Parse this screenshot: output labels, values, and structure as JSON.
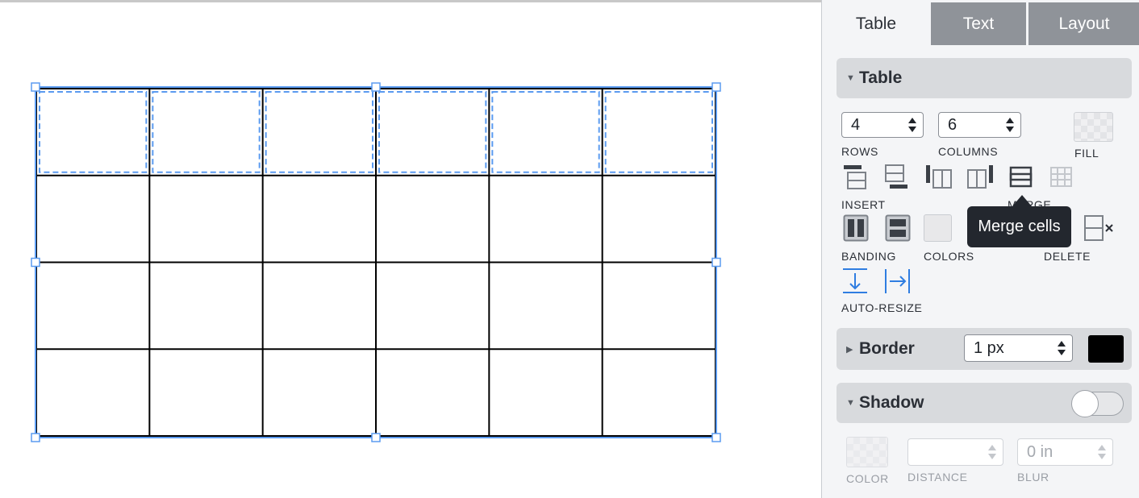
{
  "tabs": [
    {
      "label": "Table",
      "active": true
    },
    {
      "label": "Text",
      "active": false
    },
    {
      "label": "Layout",
      "active": false
    }
  ],
  "table_section": {
    "title": "Table",
    "rows_value": "4",
    "columns_value": "6",
    "rows_label": "ROWS",
    "columns_label": "COLUMNS",
    "fill_label": "FILL",
    "insert_label": "INSERT",
    "merge_label": "MERGE",
    "banding_label": "BANDING",
    "colors_label": "COLORS",
    "delete_label": "DELETE",
    "autoresize_label": "AUTO-RESIZE",
    "tooltip": "Merge cells"
  },
  "border_section": {
    "title": "Border",
    "width_value": "1 px",
    "color": "#000000"
  },
  "shadow_section": {
    "title": "Shadow",
    "enabled": false,
    "color_label": "COLOR",
    "distance_label": "DISTANCE",
    "distance_value": "",
    "blur_label": "BLUR",
    "blur_value": "0 in"
  },
  "table_grid": {
    "rows": 4,
    "columns": 6,
    "selected_row": 1,
    "selection_color": "#5b9bf0",
    "line_color": "#000000"
  }
}
